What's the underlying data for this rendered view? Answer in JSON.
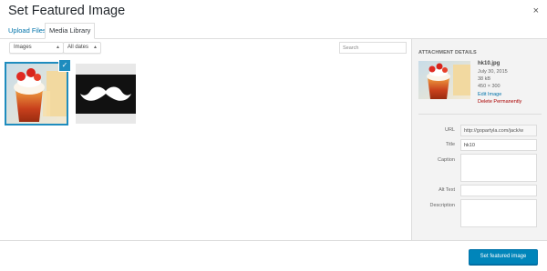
{
  "modal": {
    "title": "Set Featured Image",
    "close_glyph": "×"
  },
  "tabs": [
    {
      "label": "Upload Files",
      "active": false
    },
    {
      "label": "Media Library",
      "active": true
    }
  ],
  "filters": {
    "type": {
      "selected": "Images"
    },
    "date": {
      "selected": "All dates"
    },
    "search": {
      "placeholder": "Search",
      "value": ""
    }
  },
  "attachments": [
    {
      "name": "drink-thumbnail",
      "selected": true
    },
    {
      "name": "mustache-thumbnail",
      "selected": false
    }
  ],
  "details": {
    "heading": "ATTACHMENT DETAILS",
    "filename": "hk10.jpg",
    "date": "July 30, 2015",
    "size": "38 kB",
    "dimensions": "450 × 300",
    "edit_label": "Edit Image",
    "delete_label": "Delete Permanently",
    "fields": {
      "url": {
        "label": "URL",
        "value": "http://gopartyla.com/jack/w"
      },
      "title": {
        "label": "Title",
        "value": "hk10"
      },
      "caption": {
        "label": "Caption",
        "value": ""
      },
      "alt": {
        "label": "Alt Text",
        "value": ""
      },
      "description": {
        "label": "Description",
        "value": ""
      }
    }
  },
  "footer": {
    "button_label": "Set featured image"
  },
  "colors": {
    "accent": "#0073aa",
    "primary_button": "#0085ba",
    "selection": "#1e8cbe",
    "danger": "#aa0000",
    "sidebar_bg": "#f3f3f3"
  },
  "icons": {
    "close": "close-icon",
    "check": "checkmark-icon",
    "dropdown": "chevron-down-icon"
  }
}
